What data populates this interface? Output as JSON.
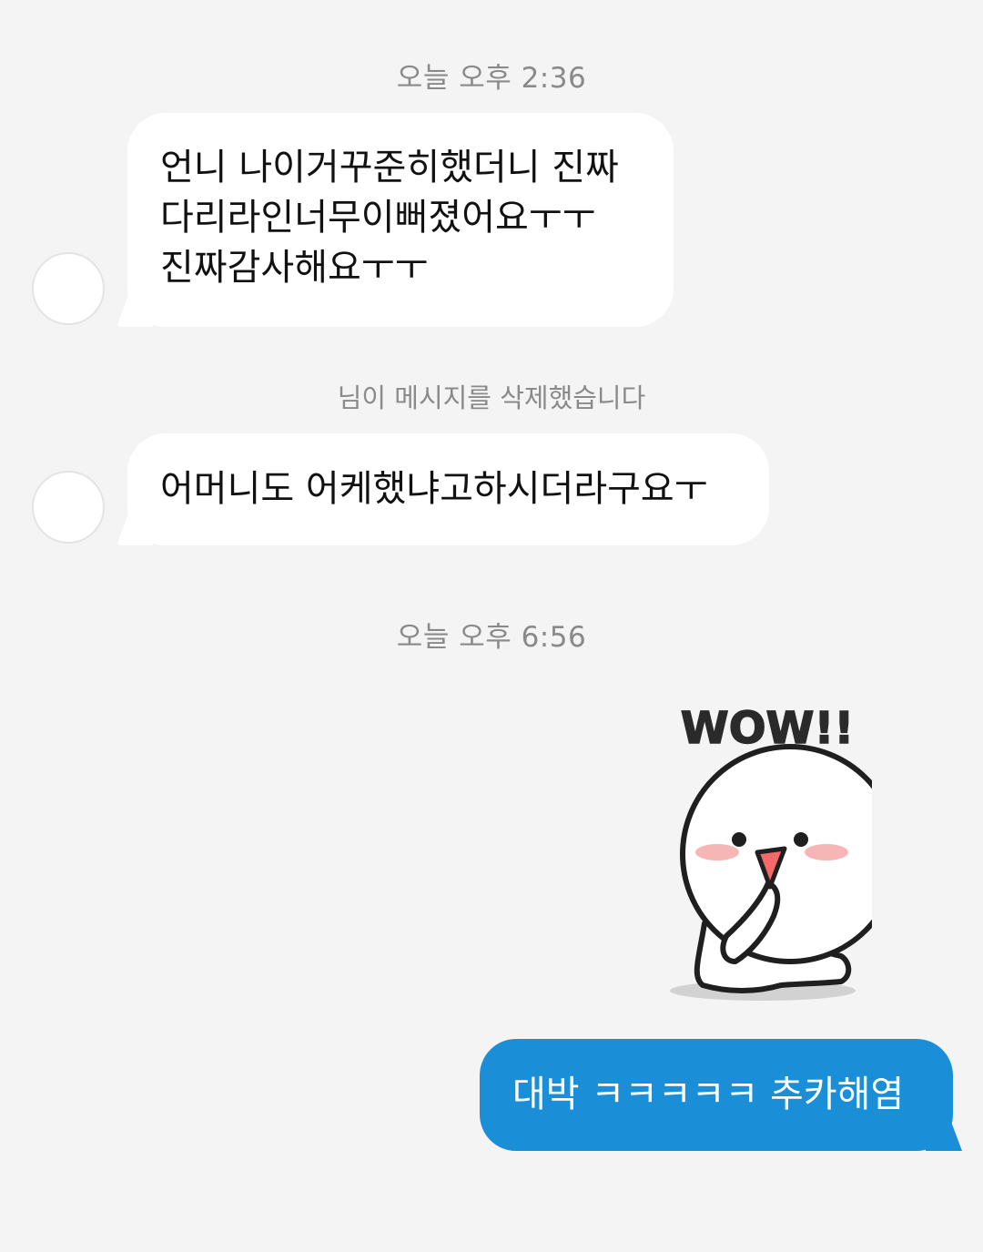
{
  "chat": {
    "timestamp_1": "오늘 오후 2:36",
    "message_1_lines": [
      "언니 나이거꾸준히했더니 진짜",
      "다리라인너무이뻐졌어요ㅜㅜ",
      "진짜감사해요ㅜㅜ"
    ],
    "deleted_notice": "님이 메시지를 삭제했습니다",
    "message_2": "어머니도 어케했냐고하시더라구요ㅜ",
    "timestamp_2": "오늘 오후 6:56",
    "sticker": {
      "text": "WOW!!",
      "description_icon": "ghost-sticker-wow"
    },
    "outgoing_message": "대박 ㅋㅋㅋㅋㅋ 추카해염"
  },
  "colors": {
    "background": "#f4f4f4",
    "incoming_bubble": "#ffffff",
    "outgoing_bubble": "#1a8fd8",
    "meta_text": "#8a8a8a"
  }
}
